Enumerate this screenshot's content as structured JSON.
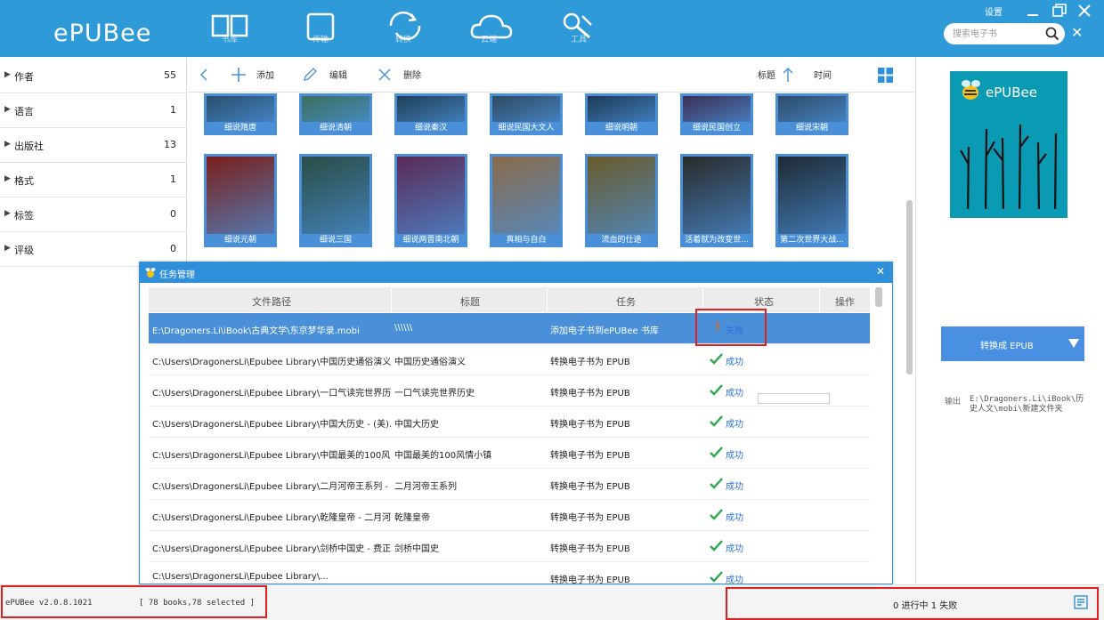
{
  "app": {
    "logo": "ePUBee",
    "settings_label": "设置",
    "search_placeholder": "搜索电子书"
  },
  "toolbar": {
    "buttons": [
      {
        "label": "书库",
        "icon": "library-icon"
      },
      {
        "label": "传输",
        "icon": "transfer-icon"
      },
      {
        "label": "转换",
        "icon": "convert-icon"
      },
      {
        "label": "云端",
        "icon": "cloud-icon"
      },
      {
        "label": "工具",
        "icon": "tools-icon"
      }
    ]
  },
  "sidebar": {
    "items": [
      {
        "name": "作者",
        "count": "55"
      },
      {
        "name": "语言",
        "count": "1"
      },
      {
        "name": "出版社",
        "count": "13"
      },
      {
        "name": "格式",
        "count": "1"
      },
      {
        "name": "标签",
        "count": "0"
      },
      {
        "name": "评级",
        "count": "0"
      }
    ]
  },
  "main_toolbar": {
    "add": "添加",
    "edit": "编辑",
    "delete": "删除",
    "sort_title": "标题",
    "sort_time": "时间"
  },
  "books_row1": [
    "细说隋唐",
    "细说清朝",
    "细说秦汉",
    "细说民国大文人",
    "细说明朝",
    "细说民国创立",
    "细说宋朝"
  ],
  "books_row2": [
    "细说元朝",
    "细说三国",
    "细说两晋南北朝",
    "真相与自白",
    "流血的仕途",
    "活着就为改变世...",
    "第二次世界大战..."
  ],
  "book_colors_row1": [
    "#2a4f6e",
    "#3b6f5e",
    "#1f3f56",
    "#2f4a62",
    "#1d3a56",
    "#3c2f55",
    "#2e4b68"
  ],
  "book_colors_row2": [
    "#7a1f1a",
    "#2a4d45",
    "#5a2a55",
    "#8a6a4a",
    "#6a5a2a",
    "#2a2a2a",
    "#1f2a33"
  ],
  "right_panel": {
    "cover_title": "ePUBee",
    "convert_button": "转换成 EPUB",
    "output_label": "输出",
    "output_path": "E:\\Dragoners.Li\\iBook\\历史人文\\mobi\\新建文件夹"
  },
  "dialog": {
    "title": "任务管理",
    "columns": [
      "文件路径",
      "标题",
      "任务",
      "状态",
      "操作"
    ],
    "rows": [
      {
        "path": "E:\\Dragoners.Li\\iBook\\古典文学\\东京梦华录.mobi",
        "title": "\\\\\\\\\\\\",
        "task": "添加电子书到ePUBee 书库",
        "status": "失败",
        "ok": false
      },
      {
        "path": "C:\\Users\\DragonersLi\\Epubee Library\\中国历史通俗演义 ...",
        "title": "中国历史通俗演义",
        "task": "转换电子书为 EPUB",
        "status": "成功",
        "ok": true
      },
      {
        "path": "C:\\Users\\DragonersLi\\Epubee Library\\一口气读完世界历...",
        "title": "一口气读完世界历史",
        "task": "转换电子书为 EPUB",
        "status": "成功",
        "ok": true
      },
      {
        "path": "C:\\Users\\DragonersLi\\Epubee Library\\中国大历史 - (美)...",
        "title": "中国大历史",
        "task": "转换电子书为 EPUB",
        "status": "成功",
        "ok": true
      },
      {
        "path": "C:\\Users\\DragonersLi\\Epubee Library\\中国最美的100风...",
        "title": "中国最美的100风情小镇",
        "task": "转换电子书为 EPUB",
        "status": "成功",
        "ok": true
      },
      {
        "path": "C:\\Users\\DragonersLi\\Epubee Library\\二月河帝王系列 - ...",
        "title": "二月河帝王系列",
        "task": "转换电子书为 EPUB",
        "status": "成功",
        "ok": true
      },
      {
        "path": "C:\\Users\\DragonersLi\\Epubee Library\\乾隆皇帝 - 二月河...",
        "title": "乾隆皇帝",
        "task": "转换电子书为 EPUB",
        "status": "成功",
        "ok": true
      },
      {
        "path": "C:\\Users\\DragonersLi\\Epubee Library\\剑桥中国史 - 费正...",
        "title": "剑桥中国史",
        "task": "转换电子书为 EPUB",
        "status": "成功",
        "ok": true
      },
      {
        "path": "C:\\Users\\DragonersLi\\Epubee Library\\...",
        "title": "",
        "task": "转换电子书为 EPUB",
        "status": "成功",
        "ok": true
      }
    ]
  },
  "statusbar": {
    "version": "ePUBee v2.0.8.1021",
    "book_count": "[ 78 books,78 selected ]",
    "progress": "0 进行中  1 失败"
  },
  "colors": {
    "accent": "#2f9ad8",
    "selection": "#4a90d9",
    "highlight": "#e02020",
    "success": "#2aa84a",
    "warning": "#e0641e"
  }
}
